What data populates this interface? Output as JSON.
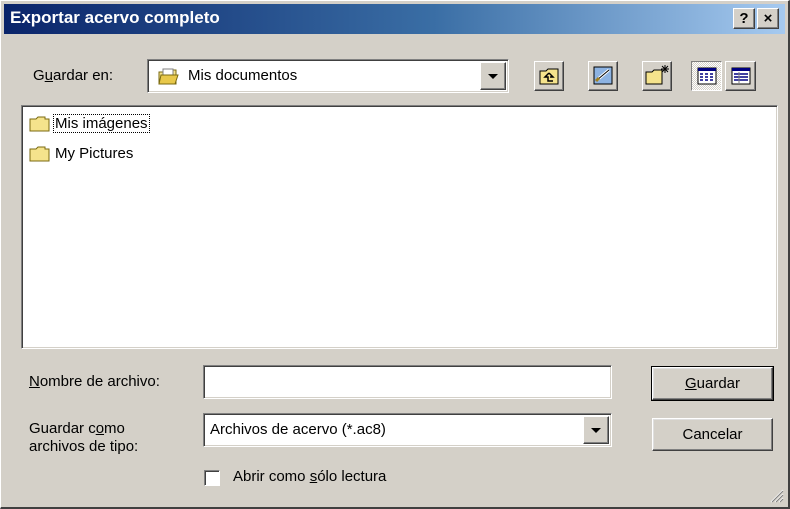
{
  "window": {
    "title": "Exportar acervo completo",
    "help_button": "?",
    "close_button": "×"
  },
  "toolbar": {
    "save_in_prefix": "G",
    "save_in_underlined": "u",
    "save_in_suffix": "ardar en:",
    "location": "Mis documentos",
    "icons": [
      "up-one-level-icon",
      "desktop-icon",
      "new-folder-icon",
      "list-view-icon",
      "details-view-icon"
    ]
  },
  "file_list": {
    "items": [
      {
        "name": "Mis imágenes",
        "icon": "folder-icon",
        "focused": true
      },
      {
        "name": "My Pictures",
        "icon": "folder-icon",
        "focused": false
      }
    ]
  },
  "filename": {
    "label_underlined": "N",
    "label_rest": "ombre de archivo:",
    "value": ""
  },
  "filetype": {
    "label_line1_prefix": "Guardar c",
    "label_line1_underlined": "o",
    "label_line1_suffix": "mo",
    "label_line2": "archivos de tipo:",
    "value": "Archivos de acervo (*.ac8)"
  },
  "readonly": {
    "label_prefix": "Abrir como ",
    "label_underlined": "s",
    "label_suffix": "ólo lectura",
    "checked": false
  },
  "buttons": {
    "save_underlined": "G",
    "save_rest": "uardar",
    "cancel": "Cancelar"
  },
  "colors": {
    "titlebar_start": "#0a246a",
    "titlebar_end": "#a6caf0",
    "face": "#d4d0c8"
  }
}
